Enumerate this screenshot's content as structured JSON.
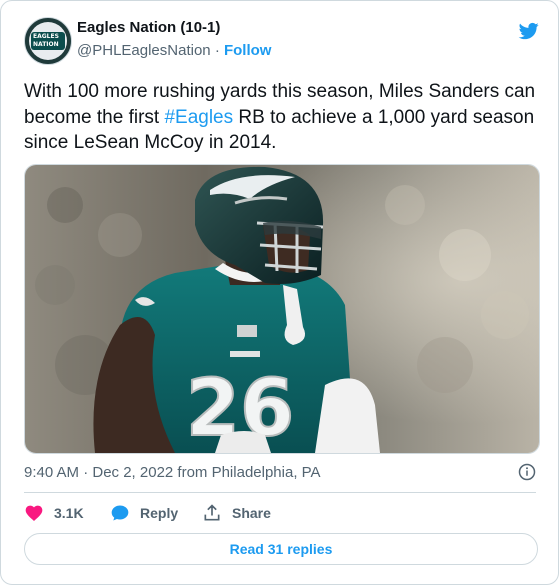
{
  "author": {
    "name": "Eagles Nation (10-1)",
    "handle": "@PHLEaglesNation",
    "separator": "·",
    "follow_label": "Follow",
    "avatar_text_line1": "EAGLES",
    "avatar_text_line2": "NATION"
  },
  "tweet": {
    "text_before": "With 100 more rushing yards this season, Miles Sanders can become the first ",
    "hashtag": "#Eagles",
    "text_after": " RB to achieve a 1,000 yard season since LeSean McCoy in 2014.",
    "photo": {
      "jersey_number": "26"
    },
    "timestamp": "9:40 AM · Dec 2, 2022 from Philadelphia, PA"
  },
  "actions": {
    "likes": "3.1K",
    "reply_label": "Reply",
    "share_label": "Share",
    "read_replies_label": "Read 31 replies"
  },
  "colors": {
    "accent": "#1d9bf0",
    "like": "#f91880",
    "text": "#0f1419",
    "muted": "#536471",
    "border": "#cfd9de",
    "jersey_green": "#0b5a5c"
  }
}
